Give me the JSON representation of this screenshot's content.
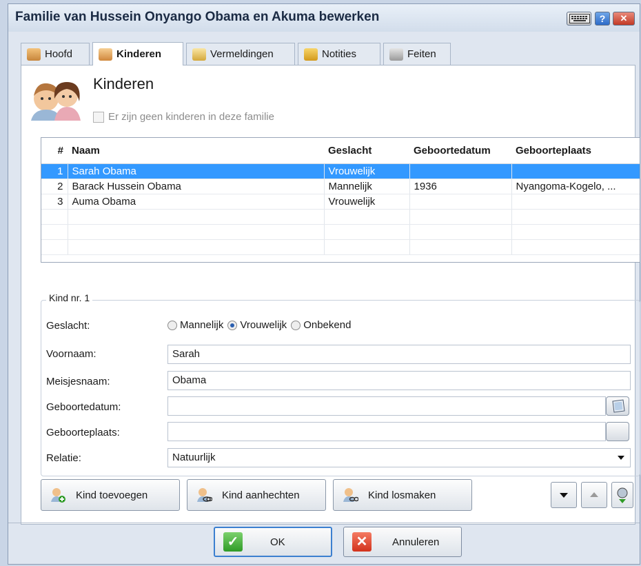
{
  "window": {
    "title": "Familie van Hussein Onyango Obama en Akuma bewerken",
    "buttons": {
      "keyboard_icon": "keyboard-icon",
      "help": "?",
      "close": "✕"
    }
  },
  "tabs": [
    {
      "label": "Hoofd",
      "icon": "family-icon",
      "active": false
    },
    {
      "label": "Kinderen",
      "icon": "children-icon",
      "active": true
    },
    {
      "label": "Vermeldingen",
      "icon": "citation-icon",
      "active": false
    },
    {
      "label": "Notities",
      "icon": "notes-icon",
      "active": false
    },
    {
      "label": "Feiten",
      "icon": "facts-icon",
      "active": false
    }
  ],
  "section": {
    "title": "Kinderen",
    "no_children_label": "Er zijn geen kinderen in deze familie"
  },
  "table": {
    "headers": [
      "#",
      "Naam",
      "Geslacht",
      "Geboortedatum",
      "Geboorteplaats"
    ],
    "rows": [
      {
        "num": "1",
        "name": "Sarah Obama",
        "gender": "Vrouwelijk",
        "birthdate": "",
        "birthplace": "",
        "selected": true
      },
      {
        "num": "2",
        "name": "Barack Hussein Obama",
        "gender": "Mannelijk",
        "birthdate": "1936",
        "birthplace": "Nyangoma-Kogelo, ...",
        "selected": false
      },
      {
        "num": "3",
        "name": "Auma Obama",
        "gender": "Vrouwelijk",
        "birthdate": "",
        "birthplace": "",
        "selected": false
      }
    ]
  },
  "child_form": {
    "legend": "Kind nr. 1",
    "gender_label": "Geslacht:",
    "gender_options": [
      "Mannelijk",
      "Vrouwelijk",
      "Onbekend"
    ],
    "gender_selected": "Vrouwelijk",
    "firstname_label": "Voornaam:",
    "firstname_value": "Sarah",
    "maidenname_label": "Meisjesnaam:",
    "maidenname_value": "Obama",
    "birthdate_label": "Geboortedatum:",
    "birthdate_value": "",
    "birthplace_label": "Geboorteplaats:",
    "birthplace_value": "",
    "relation_label": "Relatie:",
    "relation_value": "Natuurlijk"
  },
  "actions": {
    "add_child": "Kind toevoegen",
    "attach_child": "Kind aanhechten",
    "detach_child": "Kind losmaken"
  },
  "footer": {
    "ok": "OK",
    "cancel": "Annuleren"
  },
  "colors": {
    "selection": "#3399ff",
    "title_text": "#1b2b44",
    "window_bg": "#dfe6f0"
  }
}
